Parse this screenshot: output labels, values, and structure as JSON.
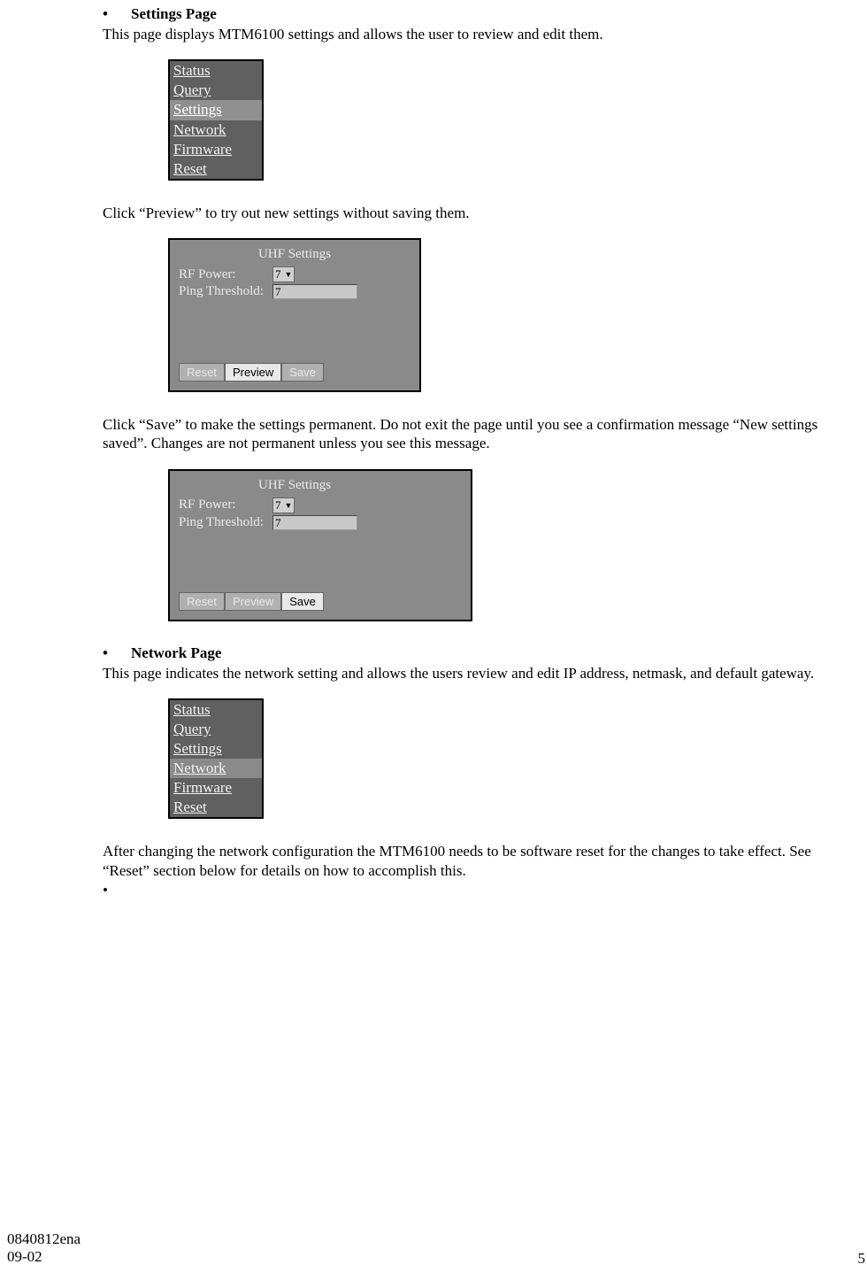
{
  "sections": {
    "settings": {
      "heading": "Settings Page",
      "intro": "This page displays MTM6100 settings and allows the user to review and edit them.",
      "previewText": "Click “Preview” to try out new settings without saving them.",
      "saveText": "Click “Save” to make the settings permanent. Do not exit the page until you see a confirmation message “New settings saved”. Changes are not permanent unless you see this message."
    },
    "network": {
      "heading": "Network Page",
      "intro": "This page indicates the network setting and allows the users review and edit IP address, netmask, and default gateway.",
      "resetNote": "After changing the network configuration the MTM6100 needs to be software reset for the changes to take effect. See “Reset” section below for details on how to accomplish this."
    }
  },
  "menu": {
    "items": [
      "Status",
      "Query",
      "Settings",
      "Network",
      "Firmware",
      "Reset"
    ]
  },
  "uhf": {
    "title": "UHF Settings",
    "rfPowerLabel": "RF Power:",
    "rfPowerValue": "7",
    "pingLabel": "Ping Threshold:",
    "pingValue": "7",
    "buttons": {
      "reset": "Reset",
      "preview": "Preview",
      "save": "Save"
    }
  },
  "footer": {
    "docId": "0840812ena",
    "date": "09-02",
    "page": "5"
  }
}
